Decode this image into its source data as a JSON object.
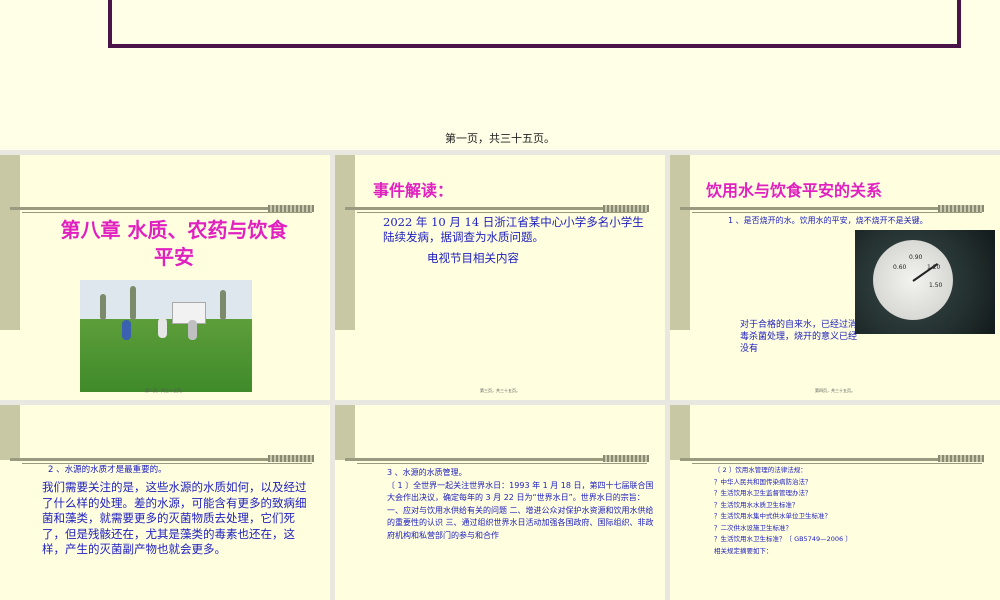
{
  "page": {
    "caption": "第一页，共三十五页。"
  },
  "slides": [
    {
      "title_line1": "第八章  水质、农药与饮食",
      "title_line2": "平安",
      "footer": "第二页，共三十五页。"
    },
    {
      "title": "事件解读：",
      "body": "2022 年 10 月 14 日浙江省某中心小学多名小学生陆续发病，据调查为水质问题。",
      "body2": "电视节目相关内容",
      "footer": "第三页，共三十五页。"
    },
    {
      "title": "饮用水与饮食平安的关系",
      "point1": "1 、是否烧开的水。饮用水的平安，烧不烧开不是关键。",
      "gauge_labels": [
        "0.60",
        "0.90",
        "1.20",
        "1.50"
      ],
      "body2": "对于合格的自来水，已经过消毒杀菌处理，烧开的意义已经没有",
      "footer": "第四页，共三十五页。"
    },
    {
      "point2": "2 、水源的水质才是最重要的。",
      "body": "我们需要关注的是，这些水源的水质如何，以及经过了什么样的处理。差的水源，可能含有更多的致病细菌和藻类，就需要更多的灭菌物质去处理，它们死了，但是残骸还在，尤其是藻类的毒素也还在，这样，产生的灭菌副产物也就会更多。"
    },
    {
      "point3": "3 、水源的水质管理。",
      "body": "〔 1 〕全世界一起关注世界水日：1993 年 1 月 18 日，第四十七届联合国大会作出决议，确定每年的 3 月 22 日为“世界水日”。世界水日的宗旨：  一、应对与饮用水供给有关的问题  二、增进公众对保护水资源和饮用水供给的重要性的认识  三、通过组织世界水日活动加强各国政府、国际组织、非政府机构和私营部门的参与和合作"
    },
    {
      "lines": [
        "〔 2 〕饮用水管理的法律法规：",
        "？中华人民共和国传染病防治法？",
        "？生活饮用水卫生监督管理办法？",
        "？生活饮用水水质卫生标准？",
        "？生活饮用水集中式供水单位卫生标准？",
        "？二次供水设施卫生标准？",
        "？生活饮用水卫生标准？〔 GB5749—2006 〕",
        "  相关规定摘要如下："
      ]
    }
  ],
  "colors": {
    "title": "#e020c0",
    "body": "#2020c0",
    "frame": "#4a1448",
    "slide_bg": "#ffffe0"
  },
  "icons": {
    "gauge_photo": "pressure-gauge-photo",
    "field_photo": "farm-field-spraying-photo"
  }
}
